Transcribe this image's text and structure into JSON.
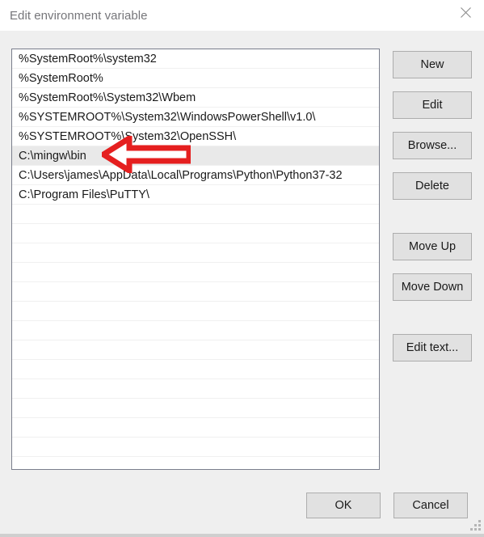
{
  "window": {
    "title": "Edit environment variable",
    "close_icon": "close-icon",
    "background_color": "#efefef",
    "titlebar_color": "#ffffff",
    "title_color": "#76767a"
  },
  "listbox": {
    "selected_index": 5,
    "selected_highlight_color": "#e9e9e9",
    "border_color": "#7a7e8c",
    "row_count_total": 21,
    "items": [
      "%SystemRoot%\\system32",
      "%SystemRoot%",
      "%SystemRoot%\\System32\\Wbem",
      "%SYSTEMROOT%\\System32\\WindowsPowerShell\\v1.0\\",
      "%SYSTEMROOT%\\System32\\OpenSSH\\",
      "C:\\mingw\\bin",
      "C:\\Users\\james\\AppData\\Local\\Programs\\Python\\Python37-32",
      "C:\\Program Files\\PuTTY\\"
    ]
  },
  "side_buttons": {
    "new_label": "New",
    "edit_label": "Edit",
    "browse_label": "Browse...",
    "delete_label": "Delete",
    "move_up_label": "Move Up",
    "move_down_label": "Move Down",
    "edit_text_label": "Edit text..."
  },
  "footer": {
    "ok_label": "OK",
    "cancel_label": "Cancel"
  },
  "annotation": {
    "name": "red-left-arrow-annotation",
    "color": "#e51f1f",
    "points_at": "C:\\mingw\\bin",
    "direction": "left"
  },
  "resize_grip": "resize-grip-icon"
}
